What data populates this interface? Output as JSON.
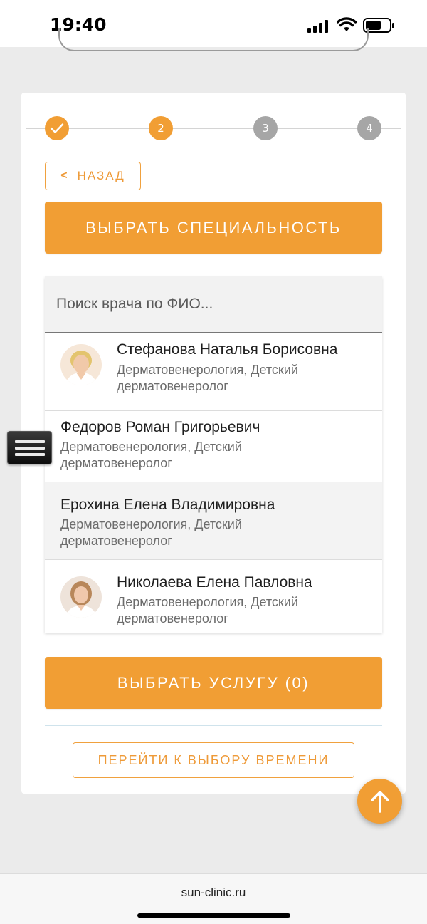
{
  "status_bar": {
    "time": "19:40"
  },
  "colors": {
    "accent": "#f19e34",
    "step_inactive": "#a6a6a6",
    "background": "#ebebeb"
  },
  "stepper": {
    "steps": [
      {
        "label": "",
        "state": "done",
        "icon": "check-icon"
      },
      {
        "label": "2",
        "state": "active"
      },
      {
        "label": "3",
        "state": "inactive"
      },
      {
        "label": "4",
        "state": "inactive"
      }
    ]
  },
  "back_button": {
    "label": "НАЗАД",
    "icon": "chevron-left-icon"
  },
  "specialty_button": {
    "label": "ВЫБРАТЬ СПЕЦИАЛЬНОСТЬ"
  },
  "search": {
    "placeholder": "Поиск врача по ФИО..."
  },
  "doctors": [
    {
      "name": "Стефанова Наталья Борисовна",
      "specialty": "Дерматовенерология, Детский дерматовенеролог",
      "has_photo": true
    },
    {
      "name": "Федоров Роман Григорьевич",
      "specialty": "Дерматовенерология, Детский дерматовенеролог",
      "has_photo": false
    },
    {
      "name": "Ерохина Елена Владимировна",
      "specialty": "Дерматовенерология, Детский дерматовенеролог",
      "has_photo": false
    },
    {
      "name": "Николаева Елена Павловна",
      "specialty": "Дерматовенерология, Детский дерматовенеролог",
      "has_photo": true
    }
  ],
  "service_button": {
    "label": "ВЫБРАТЬ УСЛУГУ (0)"
  },
  "time_button": {
    "label": "ПЕРЕЙТИ К ВЫБОРУ ВРЕМЕНИ"
  },
  "browser": {
    "url": "sun-clinic.ru"
  }
}
